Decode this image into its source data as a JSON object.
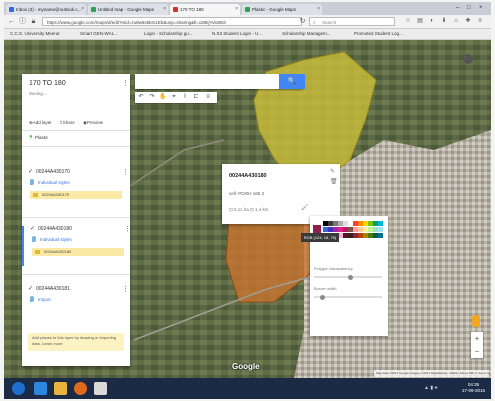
{
  "browser": {
    "tabs": [
      {
        "label": "Inbox (3) - myname@outlook.c...",
        "color": "#2a6fdb"
      },
      {
        "label": "Untitled map - Google Maps",
        "color": "#2fa24f"
      },
      {
        "label": "170 TO 180",
        "color": "#d93025"
      },
      {
        "label": "Plastic - Google Maps",
        "color": "#2fa24f"
      }
    ],
    "url": "https://www.google.com/maps/d/edit?mid=zu8w6s5bm1Eb&usp=sharing&ll=xzBkjYvlo9bS",
    "search_placeholder": "Search",
    "bookmarks": [
      "C.C.S. University Meerut",
      "Smart GEN-WAL...",
      "Login - Scholarship gu...",
      "N.S3 Student Login - U...",
      "Scholarship Managem...",
      "Promoted Student Log..."
    ],
    "window_controls": [
      "–",
      "□",
      "×"
    ]
  },
  "panel": {
    "title": "170 TO 180",
    "subtitle": "Saving...",
    "actions": {
      "add_layer": "Add layer",
      "share": "Share",
      "preview": "Preview"
    },
    "base_layer": "Plastic",
    "layers": [
      {
        "name": "00244A430170",
        "style": "Individual styles",
        "item": "00244A430170",
        "swatch": "#e5b826"
      },
      {
        "name": "00244A430180",
        "style": "Individual styles",
        "item": "00244A430180",
        "swatch": "#e5b826"
      },
      {
        "name": "00244A430181",
        "style": "Import"
      }
    ],
    "hint": "Add places to this layer by drawing or importing data. Learn more"
  },
  "map": {
    "search_button": "🔍",
    "tools": [
      "↶",
      "↷",
      "✋",
      "⌖",
      "⌇",
      "⊏",
      "≡"
    ],
    "google_label": "Google",
    "attribution": "Map data ©2017 Google Imagery ©2017 DigitalGlobe, CNES / Airbus 500 m Terms Send feedback"
  },
  "info_card": {
    "title": "00244A430180",
    "field": "cell: POOH 165 3",
    "meta": "⊡ 0.11 ha  ⊡ 1.4 km"
  },
  "color_picker": {
    "tooltip": "RGB (124, 18, 79)",
    "label_transparency": "Polygon transparency",
    "label_width": "Border width",
    "selected": "#8f1f4d",
    "colors": [
      "#000000",
      "#3c3c3c",
      "#777777",
      "#b0b0b0",
      "#e0e0e0",
      "#ffffff",
      "#ff3d3d",
      "#ff8a00",
      "#ffd600",
      "#7ec400",
      "#00a06e",
      "#00b7d6",
      "#2d6cd9",
      "#4c2fb8",
      "#9c27b0",
      "#e0218a",
      "#c2185b",
      "#795548",
      "#ff9aa2",
      "#ffcf91",
      "#fff2a0",
      "#c6ef9b",
      "#9fe3c7",
      "#a6e3f0",
      "#a6c2f0",
      "#c3b3e6",
      "#e3b3ec",
      "#f3b3d5",
      "#5a0f2a",
      "#3b1f0e",
      "#8f1f4d",
      "#b34700",
      "#a38600",
      "#4b7a00",
      "#006046",
      "#00718a"
    ]
  },
  "taskbar": {
    "clock_time": "04:35",
    "clock_date": "27-09-2016",
    "icons": [
      {
        "name": "start",
        "color": "#1f6fd1"
      },
      {
        "name": "ie",
        "color": "#2c86e0"
      },
      {
        "name": "explorer",
        "color": "#e9b43c"
      },
      {
        "name": "firefox",
        "color": "#e06a1b"
      },
      {
        "name": "media",
        "color": "#d9d9d9"
      }
    ]
  }
}
